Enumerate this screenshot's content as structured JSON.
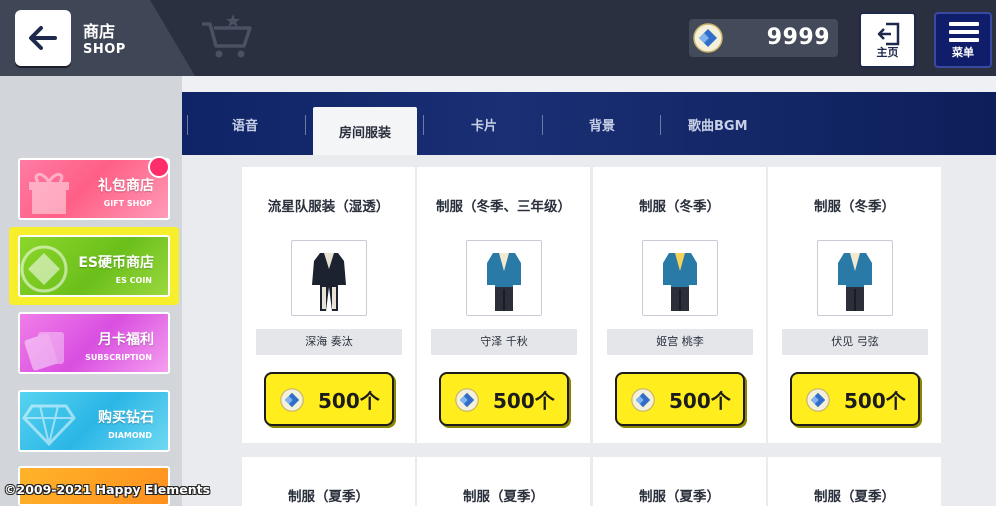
{
  "header": {
    "title": "商店",
    "subtitle": "SHOP",
    "coins": "9999",
    "home_label": "主页",
    "menu_label": "菜单"
  },
  "sidebar": {
    "cards": [
      {
        "zh": "礼包商店",
        "en": "GIFT SHOP"
      },
      {
        "zh": "ES硬币商店",
        "en": "ES COIN"
      },
      {
        "zh": "月卡福利",
        "en": "SUBSCRIPTION"
      },
      {
        "zh": "购买钻石",
        "en": "DIAMOND"
      }
    ]
  },
  "tabs": [
    "语音",
    "房间服装",
    "卡片",
    "背景",
    "歌曲BGM"
  ],
  "active_tab": "房间服装",
  "items": [
    {
      "name": "流星队服装（湿透）",
      "character": "深海 奏汰",
      "price": "500个",
      "outfit_color": "#1d2230"
    },
    {
      "name": "制服（冬季、三年级）",
      "character": "守泽 千秋",
      "price": "500个",
      "outfit_color": "#2a7aa8"
    },
    {
      "name": "制服（冬季）",
      "character": "姬宫 桃李",
      "price": "500个",
      "outfit_color": "#2a7aa8"
    },
    {
      "name": "制服（冬季）",
      "character": "伏见 弓弦",
      "price": "500个",
      "outfit_color": "#2a7aa8"
    }
  ],
  "items_row2": [
    {
      "name": "制服（夏季）"
    },
    {
      "name": "制服（夏季）"
    },
    {
      "name": "制服（夏季）"
    },
    {
      "name": "制服（夏季）"
    }
  ],
  "copyright": "©2009-2021 Happy Elements",
  "colors": {
    "topbar": "#2a303f",
    "tabbar": "#0f2466",
    "price_button": "#ffed1e",
    "coin_card_highlight": "#f7ee2c"
  }
}
